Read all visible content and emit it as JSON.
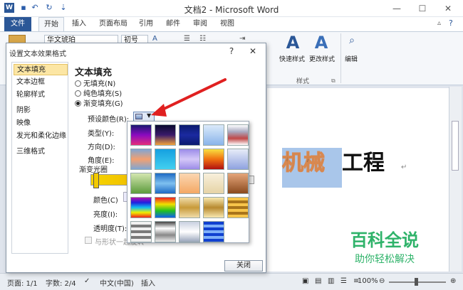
{
  "window": {
    "title": "文档2 - Microsoft Word",
    "minimize": "—",
    "maximize": "☐",
    "close": "✕"
  },
  "quick_access": {
    "undo": "↶",
    "redo": "↻",
    "more": "⇣"
  },
  "tabs": [
    "文件",
    "开始",
    "插入",
    "页面布局",
    "引用",
    "邮件",
    "审阅",
    "视图"
  ],
  "ribbon": {
    "font_name": "华文琥珀",
    "font_size": "初号",
    "styles_quick": "快速样式",
    "styles_change": "更改样式",
    "styles_group": "样式",
    "edit": "编辑"
  },
  "dialog": {
    "title": "设置文本效果格式",
    "help": "?",
    "close": "✕",
    "nav": [
      "文本填充",
      "文本边框",
      "轮廓样式",
      "阴影",
      "映像",
      "发光和柔化边缘",
      "三维格式"
    ],
    "panel_title": "文本填充",
    "options": [
      "无填充(N)",
      "纯色填充(S)",
      "渐变填充(G)"
    ],
    "preset_label": "预设颜色(R):",
    "type_label": "类型(Y):",
    "direction_label": "方向(D):",
    "angle_label": "角度(E):",
    "stops_label": "渐变光圈",
    "color_label": "颜色(C)",
    "brightness_label": "亮度(I):",
    "transparency_label": "透明度(T):",
    "rotate_label": "与形状一起旋转",
    "close_button": "关闭"
  },
  "document": {
    "text_a": "机械",
    "text_b": "工程"
  },
  "watermark": {
    "line1": "百科全说",
    "line2": "助你轻松解决"
  },
  "status": {
    "page": "页面: 1/1",
    "words": "字数: 2/4",
    "lang": "中文(中国)",
    "mode": "插入",
    "zoom": "100%"
  }
}
